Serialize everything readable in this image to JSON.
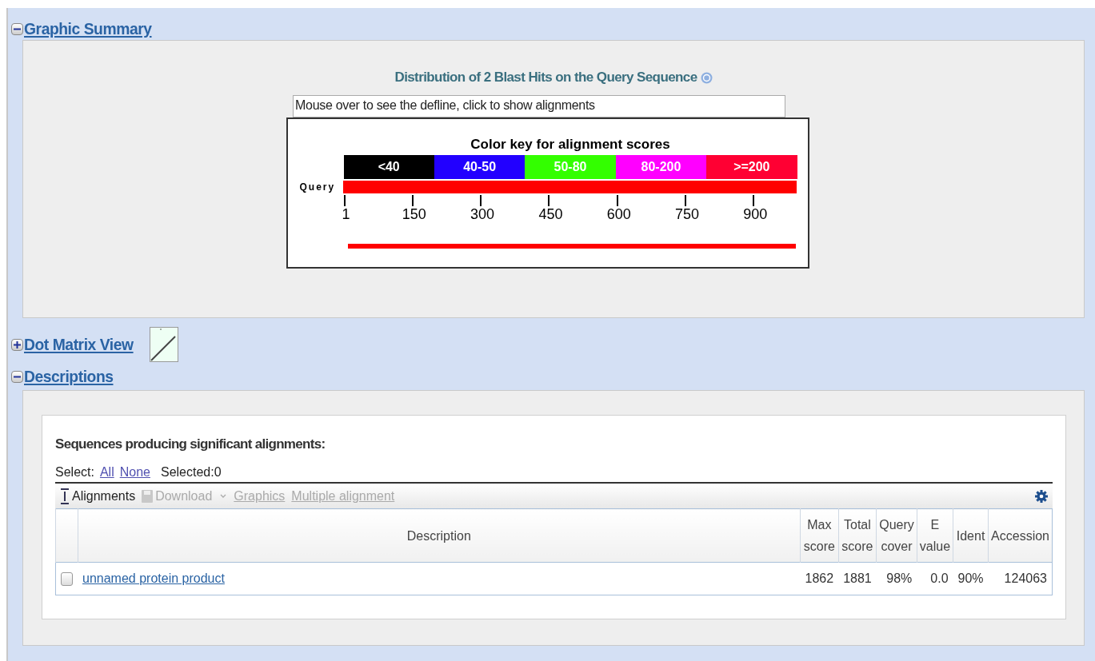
{
  "sections": [
    {
      "kind": "graphic",
      "title": "Graphic Summary",
      "expanded": true,
      "graphic": {
        "title": "Distribution of 2 Blast Hits on the Query Sequence",
        "defline": "Mouse over to see the defline, click to show alignments",
        "key_title": "Color key for alignment scores",
        "key": [
          {
            "label": "<40",
            "color": "#000000"
          },
          {
            "label": "40-50",
            "color": "#2200ff"
          },
          {
            "label": "50-80",
            "color": "#33ff00"
          },
          {
            "label": "80-200",
            "color": "#ff00ff"
          },
          {
            "label": ">=200",
            "color": "#ff0033"
          }
        ],
        "query_label": "Query",
        "ticks": [
          "1",
          "150",
          "300",
          "450",
          "600",
          "750",
          "900"
        ]
      }
    },
    {
      "kind": "dotmatrix",
      "title": "Dot Matrix View",
      "expanded": false
    },
    {
      "kind": "descriptions",
      "title": "Descriptions",
      "expanded": true,
      "heading": "Sequences producing significant alignments:",
      "select": {
        "label": "Select:",
        "links": [
          "All",
          "None"
        ],
        "selected_text": "Selected:0"
      },
      "toolbar": [
        {
          "kind": "alignments",
          "label": "Alignments",
          "disabled": false
        },
        {
          "kind": "download",
          "label": "Download",
          "disabled": true
        },
        {
          "kind": "link",
          "label": "Graphics",
          "disabled": true
        },
        {
          "kind": "link",
          "label": "Multiple alignment",
          "disabled": true
        }
      ],
      "table": {
        "columns": [
          {
            "bottom": "Description"
          },
          {
            "top": "Max",
            "bottom": "score"
          },
          {
            "top": "Total",
            "bottom": "score"
          },
          {
            "top": "Query",
            "bottom": "cover"
          },
          {
            "top": "E",
            "bottom": "value"
          },
          {
            "bottom": "Ident"
          },
          {
            "bottom": "Accession"
          }
        ],
        "rows": [
          {
            "checked": false,
            "cells": [
              "unnamed protein product",
              "1862",
              "1881",
              "98%",
              "0.0",
              "90%",
              "124063"
            ]
          }
        ]
      }
    }
  ]
}
